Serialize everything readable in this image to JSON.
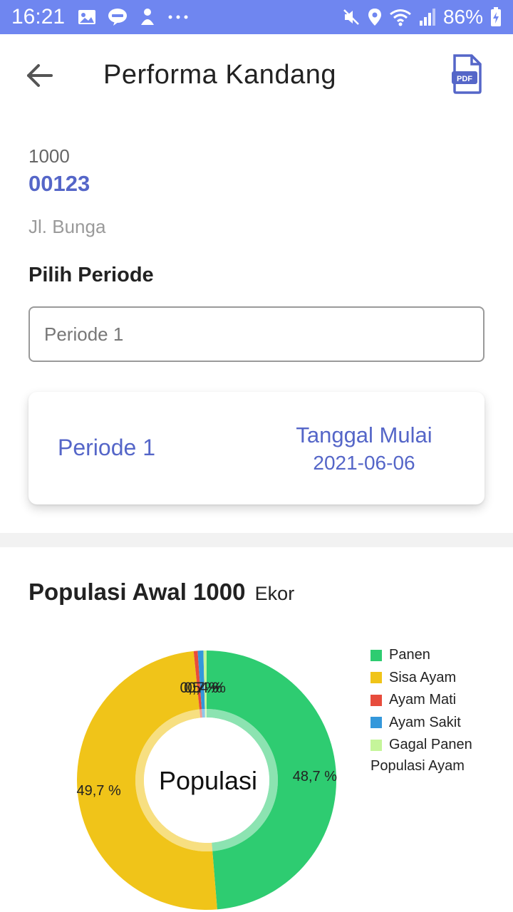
{
  "status_bar": {
    "time": "16:21",
    "battery": "86%",
    "icons_left": [
      "image-icon",
      "line-app-icon",
      "notification-icon",
      "more-icon"
    ],
    "icons_right": [
      "mute-icon",
      "location-icon",
      "wifi-icon",
      "signal-icon",
      "battery-icon"
    ]
  },
  "header": {
    "title": "Performa Kandang",
    "back_icon": "arrow-left-icon",
    "pdf_icon": "pdf-file-icon",
    "pdf_label": "PDF"
  },
  "farm": {
    "code": "1000",
    "id": "00123",
    "address": "Jl. Bunga"
  },
  "period_select": {
    "label": "Pilih Periode",
    "value": "Periode 1"
  },
  "period_card": {
    "name": "Periode 1",
    "date_label": "Tanggal Mulai",
    "date": "2021-06-06"
  },
  "population": {
    "title_prefix": "Populasi Awal",
    "count": "1000",
    "unit": "Ekor"
  },
  "colors": {
    "accent": "#5566c8",
    "status_bar": "#6f86f0"
  },
  "chart_data": {
    "type": "pie",
    "title": "",
    "center_text": "Populasi",
    "legend_title": "Populasi Ayam",
    "legend_position": "right",
    "labels": [
      "Panen",
      "Sisa Ayam",
      "Ayam Mati",
      "Ayam Sakit",
      "Gagal Panen"
    ],
    "values": [
      48.7,
      49.7,
      0.5,
      0.7,
      0.4
    ],
    "value_labels": [
      "48,7 %",
      "49,7 %",
      "0,5 %",
      "0,7 %",
      "0,4 %"
    ],
    "colors": [
      "#2ecc71",
      "#f0c419",
      "#e74c3c",
      "#3498db",
      "#c5f59a"
    ]
  }
}
